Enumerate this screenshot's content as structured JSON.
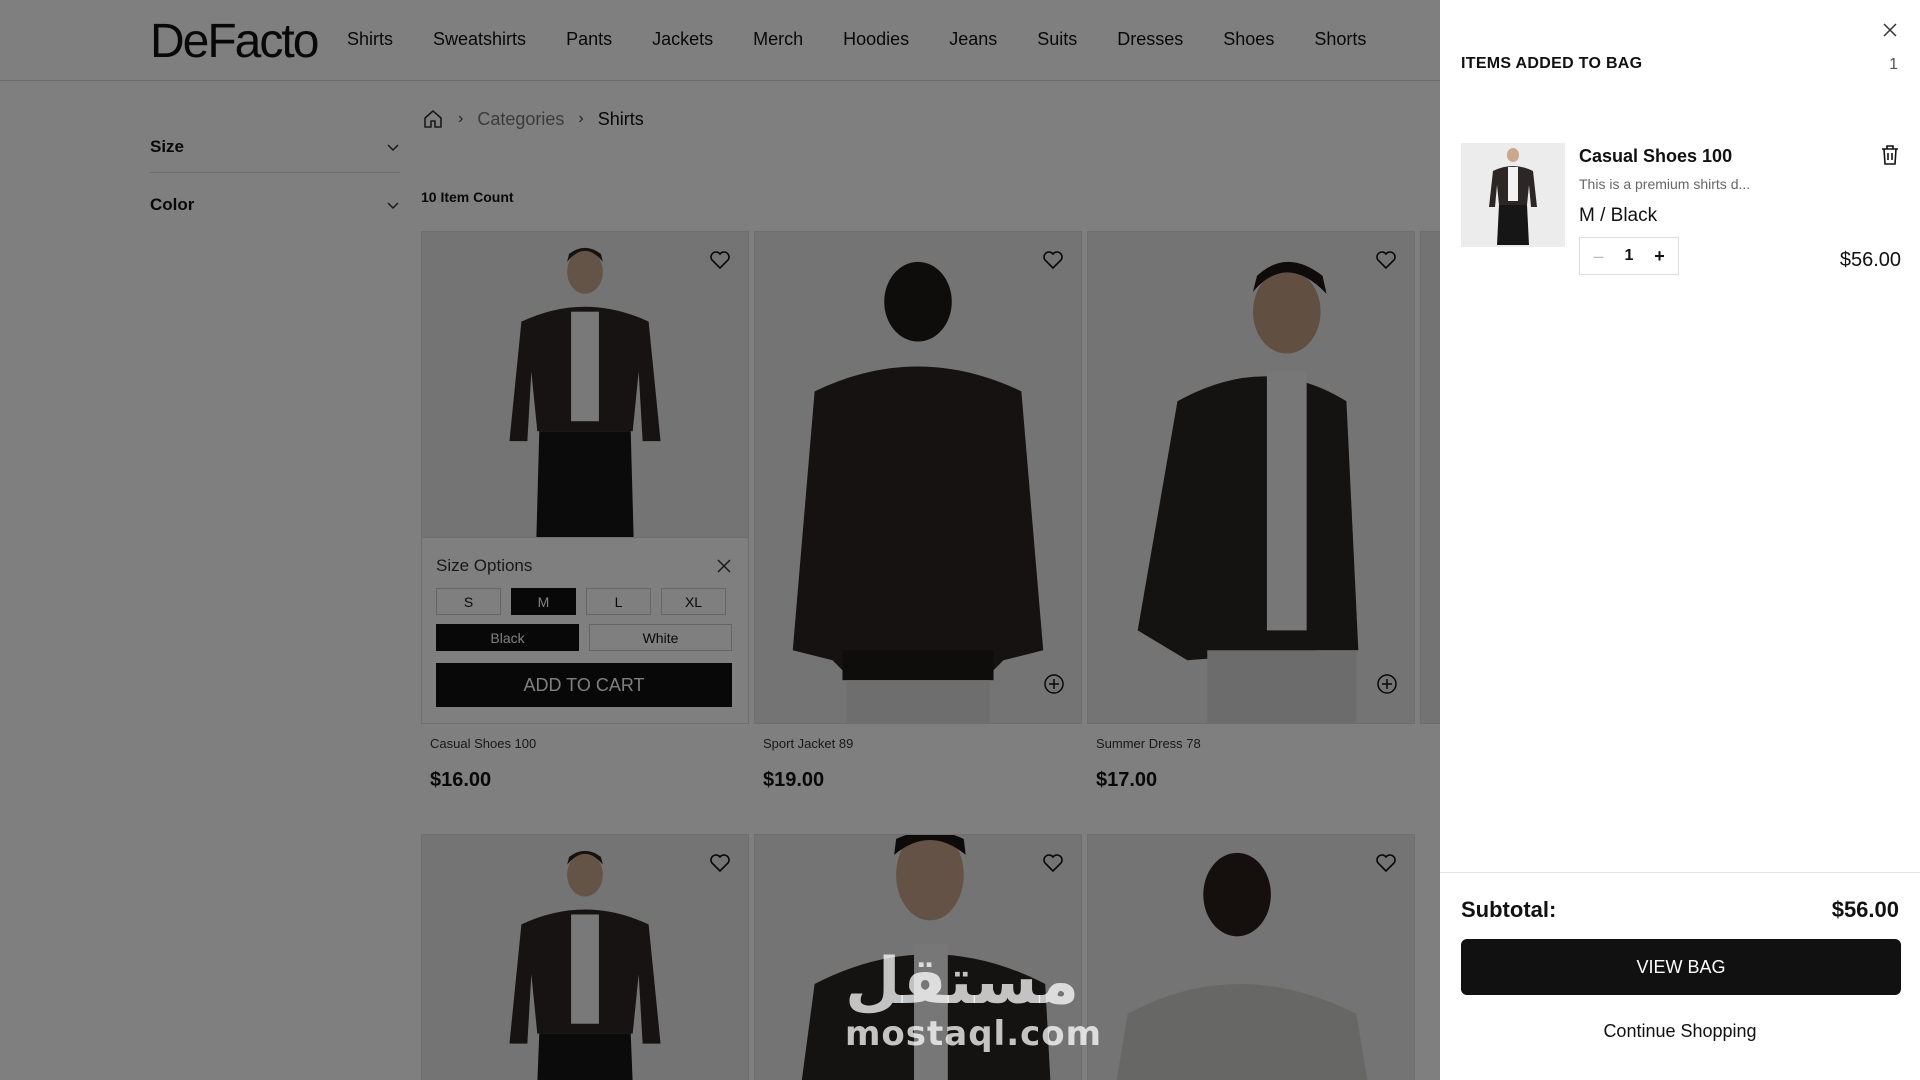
{
  "header": {
    "logo": "DeFacto",
    "nav": [
      "Shirts",
      "Sweatshirts",
      "Pants",
      "Jackets",
      "Merch",
      "Hoodies",
      "Jeans",
      "Suits",
      "Dresses",
      "Shoes",
      "Shorts"
    ]
  },
  "sidebar": {
    "filters": [
      {
        "label": "Size",
        "icon": "chevron-down-icon"
      },
      {
        "label": "Color",
        "icon": "chevron-down-icon"
      }
    ]
  },
  "breadcrumb": {
    "home_icon": "home-icon",
    "items": [
      "Categories",
      "Shirts"
    ]
  },
  "listing": {
    "item_count": "10 Item Count",
    "products": [
      {
        "name": "Casual Shoes 100",
        "price": "$16.00"
      },
      {
        "name": "Sport Jacket 89",
        "price": "$19.00"
      },
      {
        "name": "Summer Dress 78",
        "price": "$17.00"
      }
    ],
    "size_panel": {
      "title": "Size Options",
      "sizes": [
        "S",
        "M",
        "L",
        "XL"
      ],
      "selected_size": "M",
      "colors": [
        "Black",
        "White"
      ],
      "selected_color": "Black",
      "add_to_cart": "ADD TO CART"
    }
  },
  "watermark": {
    "arabic": "مستقل",
    "latin": "mostaql.com"
  },
  "cart": {
    "title": "ITEMS ADDED TO BAG",
    "count": "1",
    "items": [
      {
        "name": "Casual Shoes 100",
        "description": "This is a premium shirts d...",
        "variant": "M / Black",
        "quantity": "1",
        "price": "$56.00"
      }
    ],
    "subtotal_label": "Subtotal:",
    "subtotal_value": "$56.00",
    "view_bag": "VIEW BAG",
    "continue_shopping": "Continue Shopping"
  },
  "colors": {
    "accent": "#111111",
    "overlay": "rgba(0,0,0,0.5)"
  }
}
